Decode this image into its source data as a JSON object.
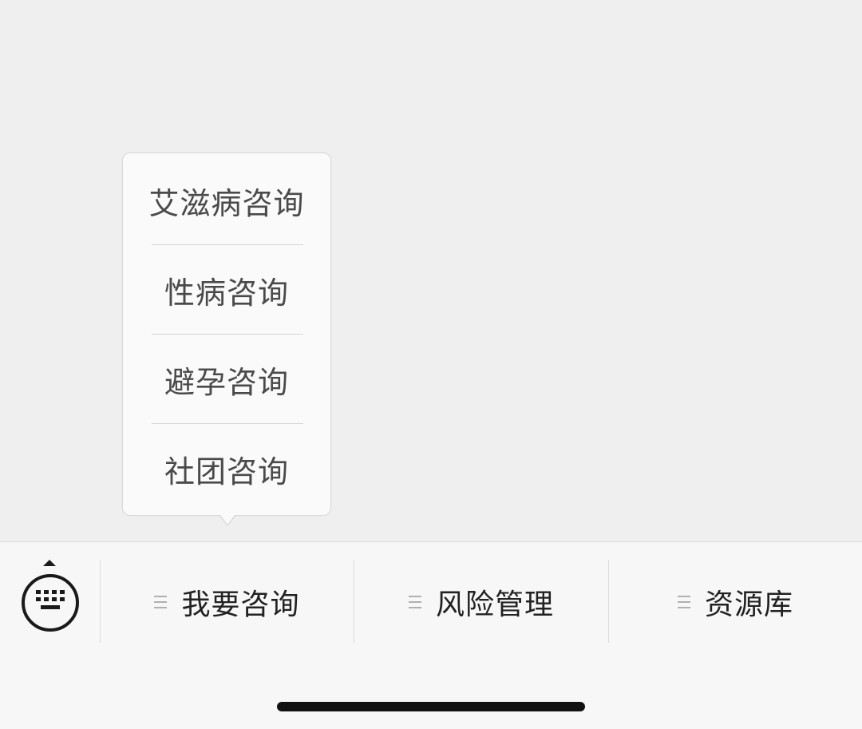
{
  "popup_menu": {
    "items": [
      {
        "label": "艾滋病咨询"
      },
      {
        "label": "性病咨询"
      },
      {
        "label": "避孕咨询"
      },
      {
        "label": "社团咨询"
      }
    ]
  },
  "menu_bar": {
    "keyboard_icon": "keyboard-icon",
    "tabs": [
      {
        "label": "我要咨询",
        "icon": "menu-lines-icon"
      },
      {
        "label": "风险管理",
        "icon": "menu-lines-icon"
      },
      {
        "label": "资源库",
        "icon": "menu-lines-icon"
      }
    ]
  },
  "colors": {
    "background": "#efefef",
    "menu_bar": "#f7f7f7",
    "popup": "#fafafa",
    "text": "#222222"
  }
}
